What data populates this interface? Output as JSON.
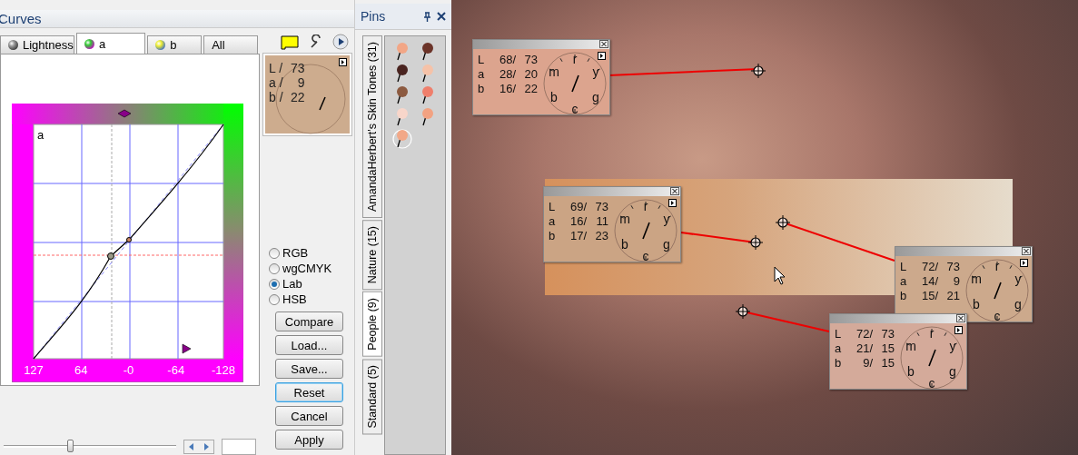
{
  "curves": {
    "title": "Curves",
    "tabs": [
      {
        "label": "Lightness",
        "selected": false,
        "kind": "lightness"
      },
      {
        "label": "a",
        "selected": true,
        "kind": "a"
      },
      {
        "label": "b",
        "selected": false,
        "kind": "b"
      },
      {
        "label": "All",
        "selected": false,
        "kind": "none"
      }
    ],
    "graph": {
      "channel": "a",
      "axis_labels": [
        "127",
        "64",
        "-0",
        "-64",
        "-128"
      ]
    },
    "readout": {
      "rows": [
        {
          "label": "L /",
          "value": "73"
        },
        {
          "label": "a /",
          "value": "9"
        },
        {
          "label": "b /",
          "value": "22"
        }
      ]
    },
    "color_modes": [
      {
        "label": "RGB",
        "selected": false
      },
      {
        "label": "wgCMYK",
        "selected": false
      },
      {
        "label": "Lab",
        "selected": true
      },
      {
        "label": "HSB",
        "selected": false
      }
    ],
    "buttons": [
      {
        "label": "Compare",
        "focused": false
      },
      {
        "label": "Load...",
        "focused": false
      },
      {
        "label": "Save...",
        "focused": false
      },
      {
        "label": "Reset",
        "focused": true
      },
      {
        "label": "Cancel",
        "focused": false
      },
      {
        "label": "Apply",
        "focused": false
      }
    ],
    "slider": {
      "level": 0.37
    }
  },
  "pins": {
    "title": "Pins",
    "tabs": [
      {
        "label": "AmandaHerbert's Skin Tones (31)",
        "selected": false
      },
      {
        "label": "Nature (15)",
        "selected": false
      },
      {
        "label": "People (9)",
        "selected": true
      },
      {
        "label": "Standard (5)",
        "selected": false
      }
    ],
    "swatches": [
      {
        "color": "#f2a686",
        "selected": false
      },
      {
        "color": "#6b3328",
        "selected": false
      },
      {
        "color": "#4a2420",
        "selected": false
      },
      {
        "color": "#f5c2a8",
        "selected": false
      },
      {
        "color": "#8c5a40",
        "selected": false
      },
      {
        "color": "#ef7f6c",
        "selected": false
      },
      {
        "color": "#f8d6ca",
        "selected": false
      },
      {
        "color": "#f2a282",
        "selected": false
      },
      {
        "color": "#f2a888",
        "selected": true
      }
    ]
  },
  "photo": {
    "readouts": [
      {
        "color": "#dca48e",
        "rows": [
          {
            "channel": "L",
            "before": "68/",
            "after": "73"
          },
          {
            "channel": "a",
            "before": "28/",
            "after": "20"
          },
          {
            "channel": "b",
            "before": "16/",
            "after": "22"
          }
        ],
        "dial": [
          "r",
          "y",
          "g",
          "c",
          "b",
          "m"
        ]
      },
      {
        "color": "#cba484",
        "rows": [
          {
            "channel": "L",
            "before": "69/",
            "after": "73"
          },
          {
            "channel": "a",
            "before": "16/",
            "after": "11"
          },
          {
            "channel": "b",
            "before": "17/",
            "after": "23"
          }
        ],
        "dial": [
          "r",
          "y",
          "g",
          "c",
          "b",
          "m"
        ]
      },
      {
        "color": "#cca98c",
        "rows": [
          {
            "channel": "L",
            "before": "72/",
            "after": "73"
          },
          {
            "channel": "a",
            "before": "14/",
            "after": "9"
          },
          {
            "channel": "b",
            "before": "15/",
            "after": "21"
          }
        ],
        "dial": [
          "r",
          "y",
          "g",
          "c",
          "b",
          "m"
        ]
      },
      {
        "color": "#d4aa9a",
        "rows": [
          {
            "channel": "L",
            "before": "72/",
            "after": "73"
          },
          {
            "channel": "a",
            "before": "21/",
            "after": "15"
          },
          {
            "channel": "b",
            "before": "9/",
            "after": "15"
          }
        ],
        "dial": [
          "r",
          "y",
          "g",
          "c",
          "b",
          "m"
        ]
      }
    ]
  }
}
